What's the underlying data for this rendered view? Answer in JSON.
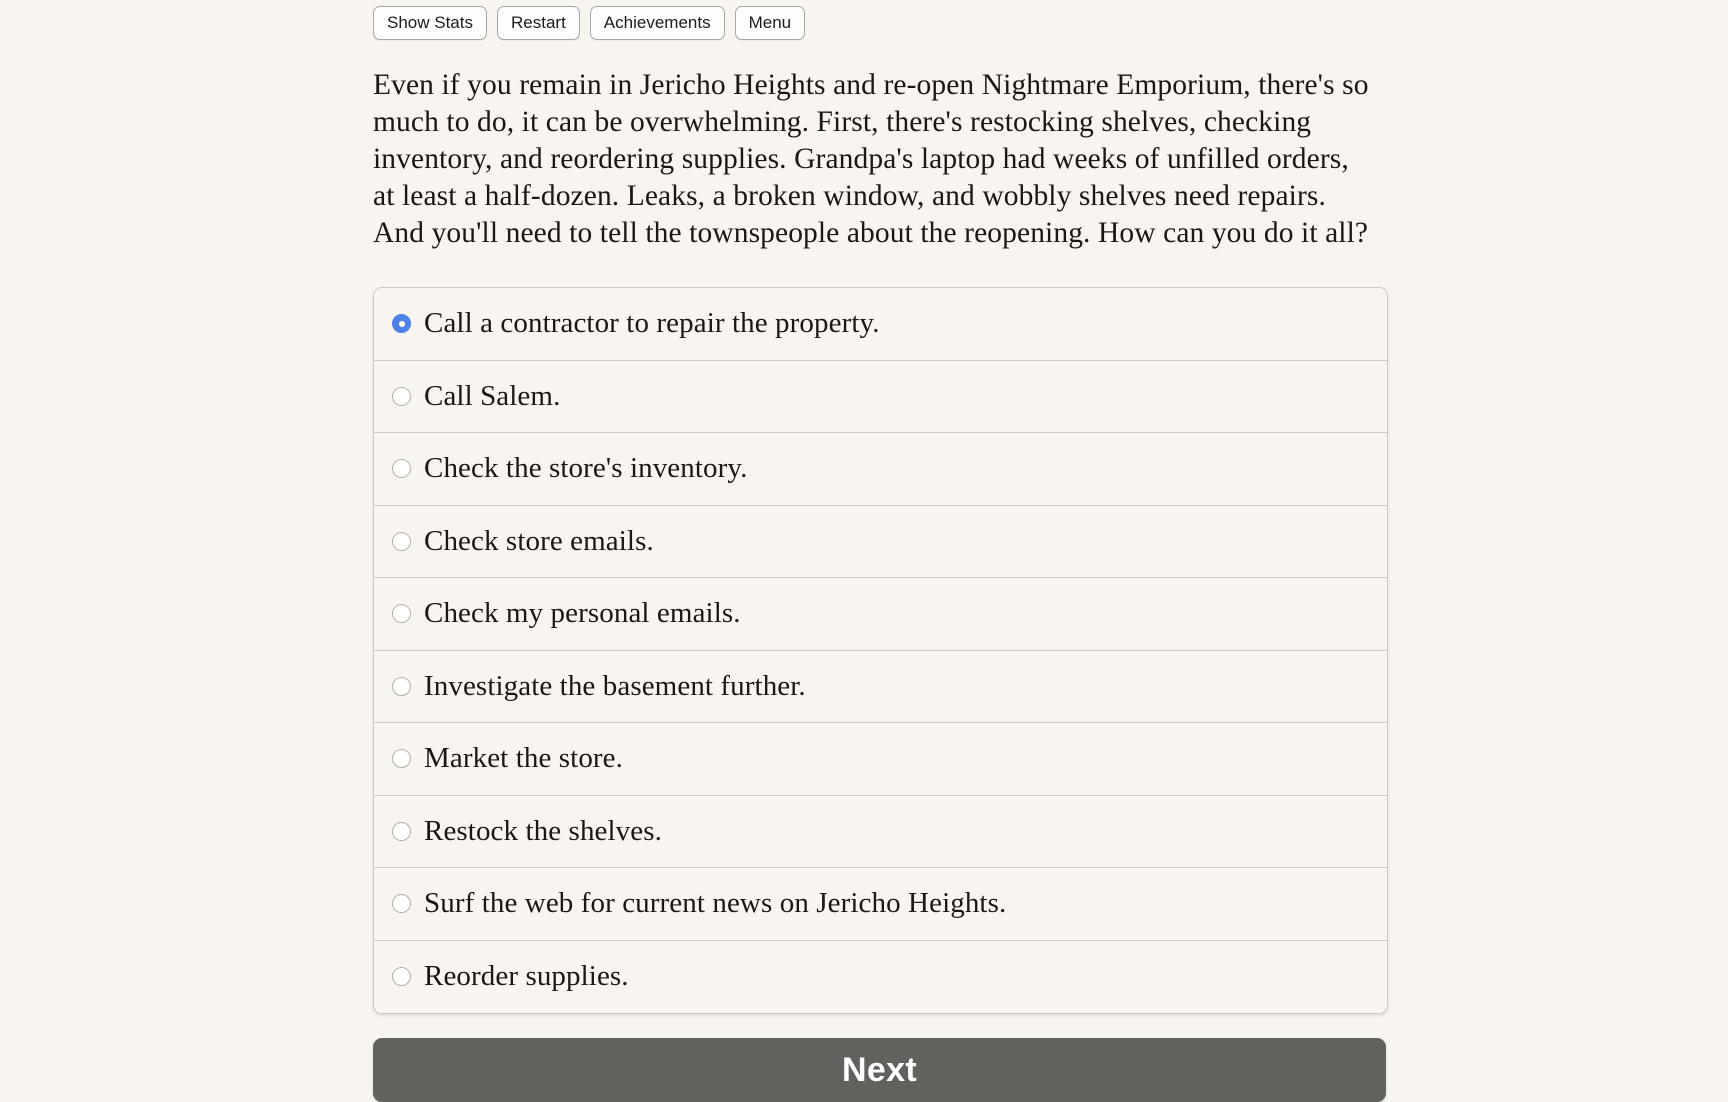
{
  "toolbar": {
    "buttons": [
      {
        "label": "Show Stats",
        "name": "show-stats-button"
      },
      {
        "label": "Restart",
        "name": "restart-button"
      },
      {
        "label": "Achievements",
        "name": "achievements-button"
      },
      {
        "label": "Menu",
        "name": "menu-button"
      }
    ]
  },
  "story": {
    "text": "Even if you remain in Jericho Heights and re-open Nightmare Emporium, there's so much to do, it can be overwhelming. First, there's restocking shelves, checking inventory, and reordering supplies. Grandpa's laptop had weeks of unfilled orders, at least a half-dozen. Leaks, a broken window, and wobbly shelves need repairs. And you'll need to tell the townspeople about the reopening. How can you do it all?"
  },
  "choices": {
    "selected_index": 0,
    "options": [
      {
        "label": "Call a contractor to repair the property."
      },
      {
        "label": "Call Salem."
      },
      {
        "label": "Check the store's inventory."
      },
      {
        "label": "Check store emails."
      },
      {
        "label": "Check my personal emails."
      },
      {
        "label": "Investigate the basement further."
      },
      {
        "label": "Market the store."
      },
      {
        "label": "Restock the shelves."
      },
      {
        "label": "Surf the web for current news on Jericho Heights."
      },
      {
        "label": "Reorder supplies."
      }
    ]
  },
  "next": {
    "label": "Next"
  },
  "colors": {
    "page_background": "#f8f5f1",
    "text": "#1b1715",
    "radio_selected": "#4e82e8",
    "next_button": "#63615e",
    "border": "#cfc9c3"
  }
}
